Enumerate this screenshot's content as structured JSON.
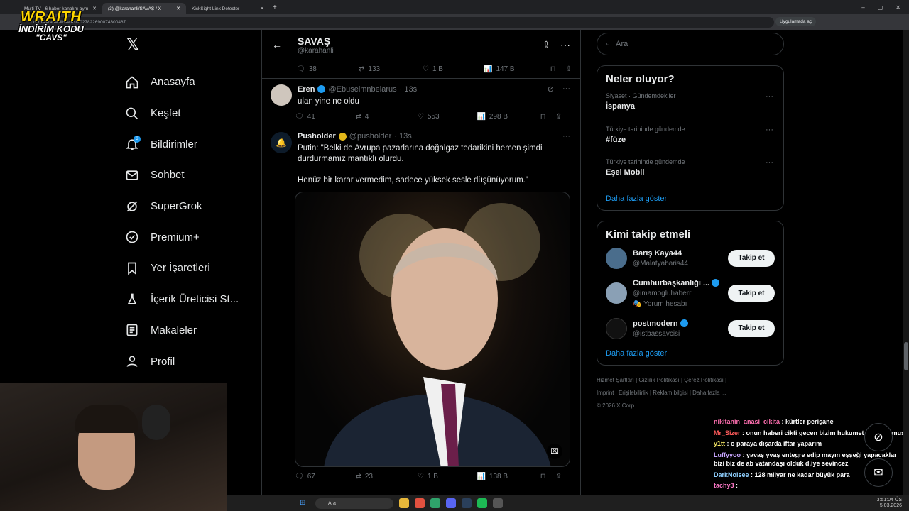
{
  "browser": {
    "tabs": [
      {
        "label": "Multi TV - 6 haber kanalını aynı"
      },
      {
        "label": "(3) @karahanli/SAVAŞ / X"
      },
      {
        "label": "KickSight Link Detector"
      }
    ],
    "url": "x.com/karahanli/status/2027822690074300467",
    "app_button": "Uygulamada aç"
  },
  "overlay": {
    "brand": "WRAITH",
    "promo_line1": "İNDİRİM KODU",
    "promo_line2": "\"CAVS\""
  },
  "nav": {
    "items": [
      {
        "label": "Anasayfa",
        "icon": "home-icon"
      },
      {
        "label": "Keşfet",
        "icon": "search-icon"
      },
      {
        "label": "Bildirimler",
        "icon": "bell-icon",
        "badge": "3"
      },
      {
        "label": "Sohbet",
        "icon": "mail-icon"
      },
      {
        "label": "SuperGrok",
        "icon": "grok-icon"
      },
      {
        "label": "Premium+",
        "icon": "verified-icon"
      },
      {
        "label": "Yer İşaretleri",
        "icon": "bookmark-icon"
      },
      {
        "label": "İçerik Üreticisi St...",
        "icon": "flask-icon"
      },
      {
        "label": "Makaleler",
        "icon": "article-icon"
      },
      {
        "label": "Profil",
        "icon": "person-icon"
      }
    ]
  },
  "header": {
    "title": "SAVAŞ",
    "handle": "@karahanli"
  },
  "main_metrics": {
    "replies": "38",
    "reposts": "133",
    "likes": "1 B",
    "views": "147 B"
  },
  "tweets": [
    {
      "name": "Eren",
      "handle": "@Ebuselmnbelarus",
      "time": "· 13s",
      "text": "ulan yine ne oldu",
      "replies": "41",
      "reposts": "4",
      "likes": "553",
      "views": "298 B"
    },
    {
      "name": "Pusholder",
      "handle": "@pusholder",
      "time": "· 13s",
      "text": "Putin: \"Belki de Avrupa pazarlarına doğalgaz tedarikini hemen şimdi durdurmamız mantıklı olurdu.\n\nHenüz bir karar vermedim, sadece yüksek sesle düşünüyorum.\"",
      "replies": "67",
      "reposts": "23",
      "likes": "1 B",
      "views": "138 B"
    }
  ],
  "search": {
    "placeholder": "Ara"
  },
  "trends": {
    "title": "Neler oluyor?",
    "items": [
      {
        "context": "Siyaset · Gündemdekiler",
        "topic": "İspanya"
      },
      {
        "context": "Türkiye tarihinde gündemde",
        "topic": "#füze"
      },
      {
        "context": "Türkiye tarihinde gündemde",
        "topic": "Eşel Mobil"
      }
    ],
    "more": "Daha fazla göster"
  },
  "who_to_follow": {
    "title": "Kimi takip etmeli",
    "button": "Takip et",
    "items": [
      {
        "name": "Barış Kaya44",
        "handle": "@Malatyabaris44",
        "extra": ""
      },
      {
        "name": "Cumhurbaşkanlığı ...",
        "handle": "@imamogluhaberr",
        "extra": "Yorum hesabı"
      },
      {
        "name": "postmodern",
        "handle": "@istbassavcisi",
        "extra": ""
      }
    ],
    "more": "Daha fazla göster"
  },
  "footer": {
    "line1": "Hizmet Şartları  |  Gizlilik Politikası  |  Çerez Politikası  |",
    "line2": "İmprint  |  Erişilebilirlik  |  Reklam bilgisi  |  Daha fazla ...",
    "line3": "© 2026 X Corp."
  },
  "chat": [
    {
      "user": "nikitanin_anasi_cikita",
      "msg": "kürtler perişane"
    },
    {
      "user": "Mr_Sizer",
      "msg": "onun haberi cikti gecen bizim hukumet istemiyomus"
    },
    {
      "user": "y1tt",
      "msg": "o paraya dışarda iftar yaparım"
    },
    {
      "user": "Luffyyoo",
      "msg": "yavaş yvaş entegre edip mayın eşşeği yapacaklar bizi biz de ab vatandaşı olduk d,iye sevincez"
    },
    {
      "user": "DarkNoisee",
      "msg": "128 milyar ne kadar büyük para"
    },
    {
      "user": "tachy3",
      "msg": ""
    }
  ],
  "taskbar": {
    "search": "Ara",
    "time": "3:51:04 ÖS",
    "date": "5.03.2026"
  }
}
